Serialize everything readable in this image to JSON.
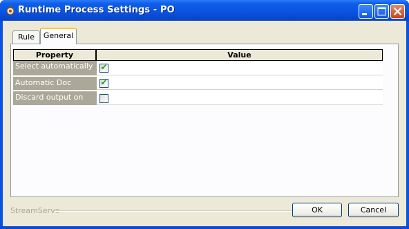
{
  "window": {
    "title": "Runtime Process Settings - PO"
  },
  "tabs": [
    {
      "label": "Rule"
    },
    {
      "label": "General"
    }
  ],
  "grid": {
    "headers": {
      "property": "Property",
      "value": "Value"
    },
    "rows": [
      {
        "name": "Select automatically",
        "checked": true
      },
      {
        "name": "Automatic Doc Trigger",
        "checked": true
      },
      {
        "name": "Discard output on failure",
        "checked": false
      }
    ]
  },
  "footer": {
    "brand": "StreamServe",
    "ok_label": "OK",
    "cancel_label": "Cancel"
  }
}
